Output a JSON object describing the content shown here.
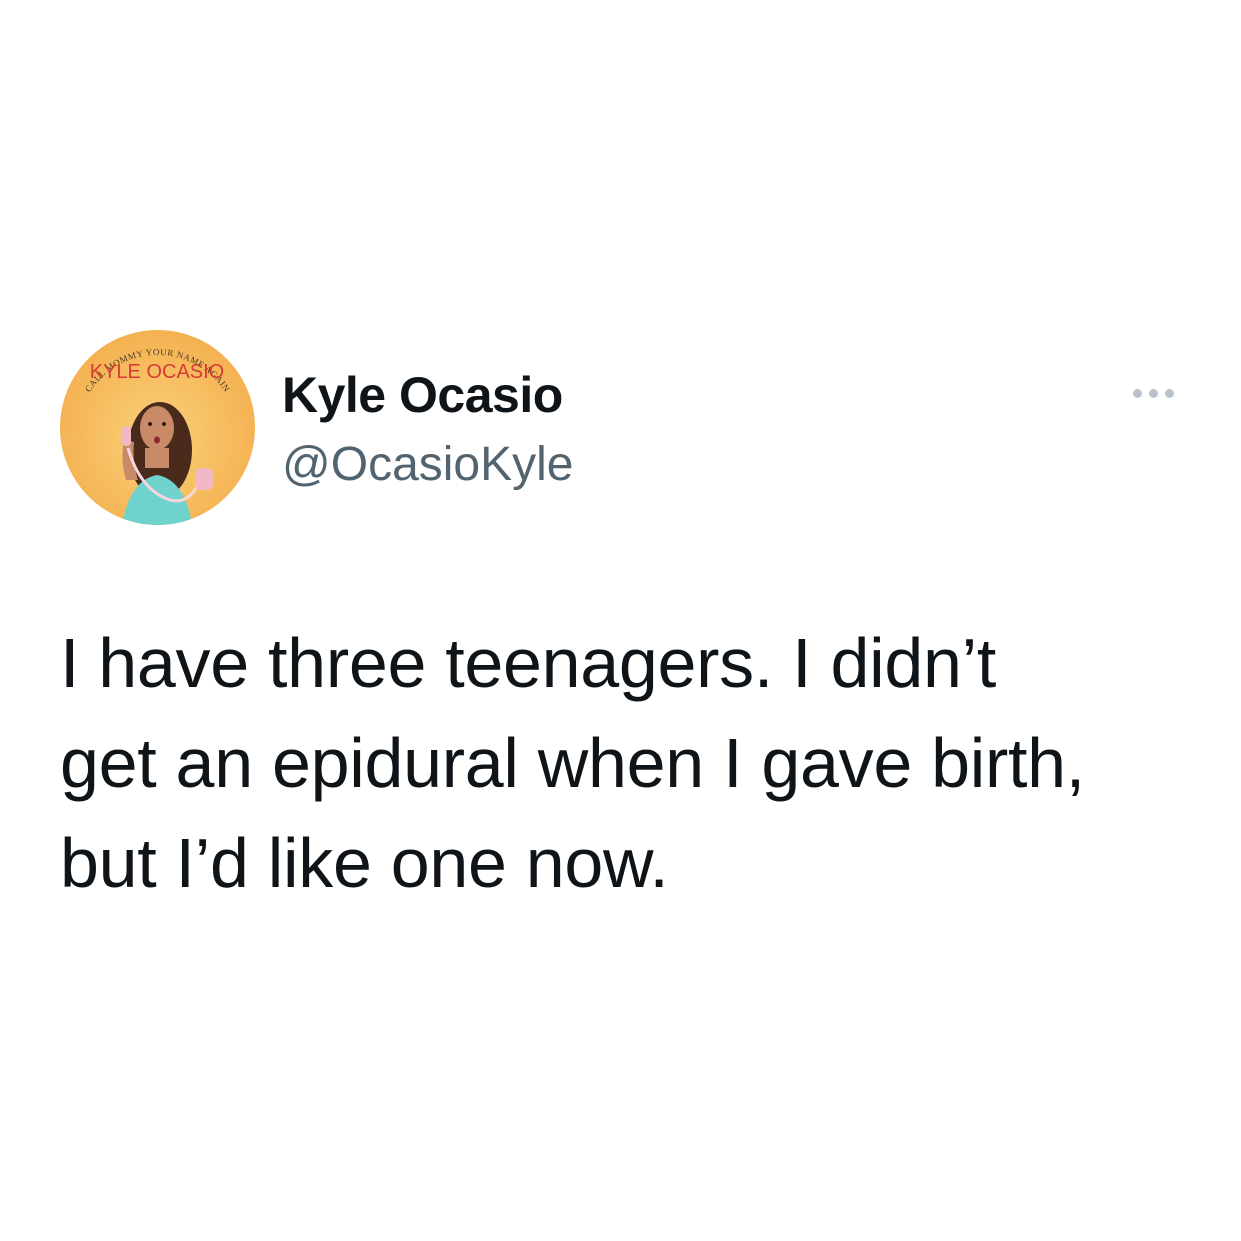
{
  "tweet": {
    "author": {
      "display_name": "Kyle Ocasio",
      "handle": "@OcasioKyle",
      "avatar": {
        "top_text": "CALL MOMMY YOUR NAME AGAIN",
        "title_text": "KYLE OCASIO",
        "background_color": "#f6b95a",
        "title_color": "#d63a34"
      }
    },
    "more_icon": "more-dots-icon",
    "text_lines": [
      "I have three teenagers. I didn’t",
      "get an epidural when I gave birth,",
      "but I’d like one now."
    ]
  }
}
